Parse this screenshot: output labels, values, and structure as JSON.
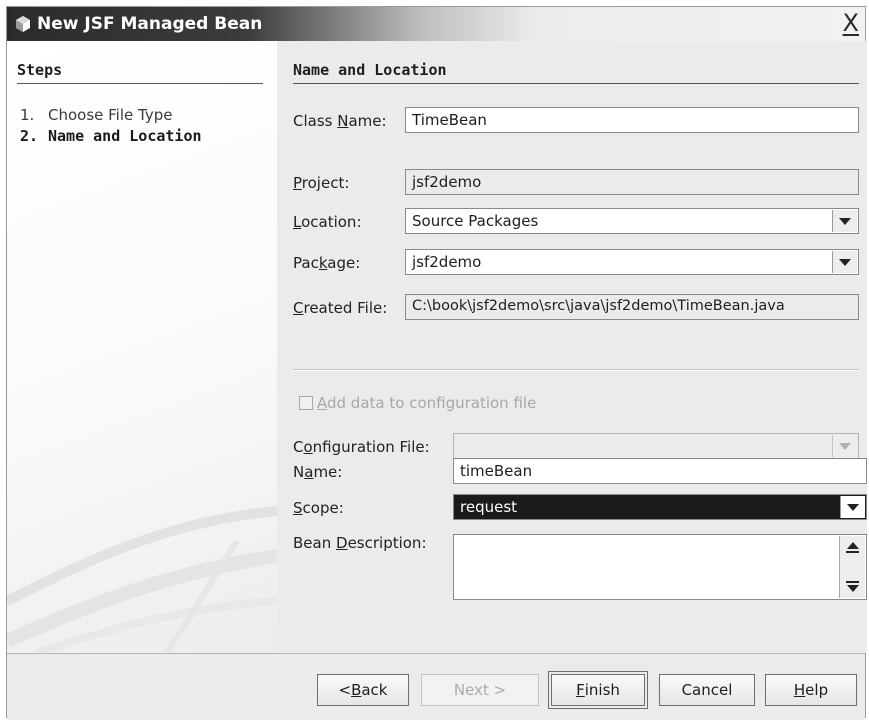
{
  "window": {
    "title": "New JSF Managed Bean",
    "close_glyph": "X",
    "icon": "bean-icon"
  },
  "steps": {
    "heading": "Steps",
    "items": [
      {
        "num": "1.",
        "label": "Choose File Type",
        "current": false
      },
      {
        "num": "2.",
        "label": "Name and Location",
        "current": true
      }
    ]
  },
  "panel": {
    "heading": "Name and Location",
    "class_name": {
      "label_pre": "Class ",
      "label_mn": "N",
      "label_post": "ame:",
      "value": "TimeBean"
    },
    "project": {
      "label_mn": "P",
      "label_post": "roject:",
      "value": "jsf2demo"
    },
    "location": {
      "label_mn": "L",
      "label_post": "ocation:",
      "value": "Source Packages"
    },
    "package": {
      "label_pre": "Pac",
      "label_mn": "k",
      "label_post": "age:",
      "value": "jsf2demo"
    },
    "created_file": {
      "label_mn": "C",
      "label_post": "reated File:",
      "value": "C:\\book\\jsf2demo\\src\\java\\jsf2demo\\TimeBean.java"
    },
    "add_config": {
      "label_mn": "A",
      "label_post": "dd data to configuration file",
      "checked": false,
      "enabled": false
    },
    "config_file": {
      "label_pre": "C",
      "label_mn": "o",
      "label_post": "nfiguration File:",
      "value": "",
      "enabled": false
    },
    "name": {
      "label_pre": "N",
      "label_mn": "a",
      "label_post": "me:",
      "value": "timeBean"
    },
    "scope": {
      "label_mn": "S",
      "label_post": "cope:",
      "value": "request"
    },
    "bean_description": {
      "label_pre": "Bean ",
      "label_mn": "D",
      "label_post": "escription:",
      "value": ""
    }
  },
  "buttons": {
    "back": {
      "pre": "< ",
      "mn": "B",
      "post": "ack",
      "enabled": true
    },
    "next": {
      "label": "Next >",
      "enabled": false
    },
    "finish": {
      "mn": "F",
      "post": "inish",
      "enabled": true
    },
    "cancel": {
      "label": "Cancel",
      "enabled": true
    },
    "help": {
      "mn": "H",
      "post": "elp",
      "enabled": true
    }
  },
  "colors": {
    "title_gradient_dark": "#2b2b2b",
    "panel_background": "#ebebeb",
    "selected_background": "#1b1b1b"
  }
}
